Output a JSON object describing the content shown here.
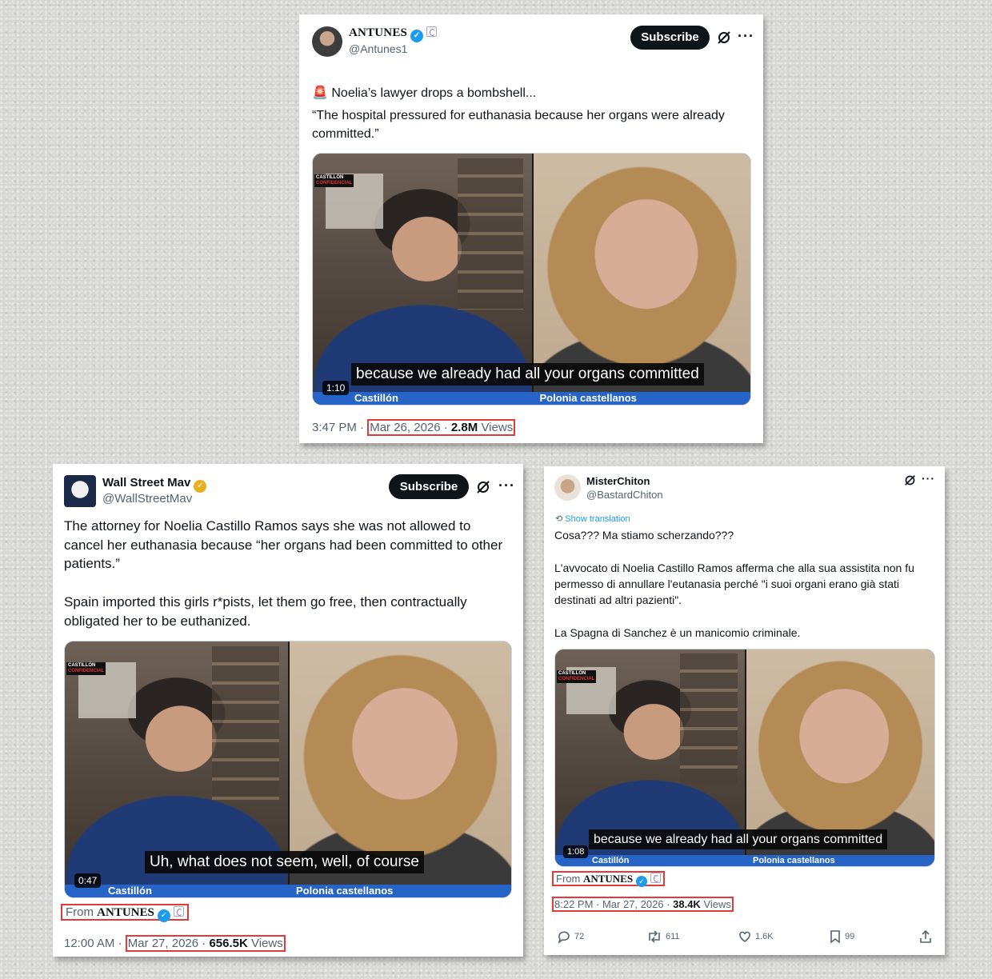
{
  "post1": {
    "author_name": "ANTUNES",
    "handle": "@Antunes1",
    "subscribe_label": "Subscribe",
    "more_label": "···",
    "emoji": "🚨",
    "text_line1": "Noelia’s lawyer drops a bombshell...",
    "text_quote": "“The hospital pressured for euthanasia because her organs were already committed.”",
    "video": {
      "caption": "because we already had all your organs committed",
      "duration": "1:10",
      "left_nameplate": "Castillón",
      "right_nameplate": "Polonia castellanos",
      "logo_line1": "CASTILLÓN",
      "logo_line2": "CONFIDENCIAL"
    },
    "time": "3:47 PM · ",
    "date": "Mar 26, 2026 · ",
    "views_count": "2.8M",
    "views_label": " Views"
  },
  "post2": {
    "author_name": "Wall Street Mav",
    "handle": "@WallStreetMav",
    "subscribe_label": "Subscribe",
    "more_label": "···",
    "text": "The attorney for Noelia Castillo Ramos says she was not allowed to cancel her euthanasia because “her organs had been committed to other patients.”\n\nSpain imported this girls r*pists, let them go free, then contractually obligated her to be euthanized.",
    "video": {
      "caption": "Uh, what does not seem, well, of course",
      "duration": "0:47",
      "left_nameplate": "Castillón",
      "right_nameplate": "Polonia castellanos",
      "logo_line1": "CASTILLÓN",
      "logo_line2": "CONFIDENCIAL"
    },
    "from_prefix": "From ",
    "from_source": "ANTUNES",
    "time": "12:00 AM · ",
    "date": "Mar 27, 2026 · ",
    "views_count": "656.5K",
    "views_label": " Views"
  },
  "post3": {
    "author_name": "MisterChiton",
    "handle": "@BastardChiton",
    "more_label": "···",
    "translate_label": "Show translation",
    "text": "Cosa??? Ma stiamo scherzando???\n\nL'avvocato di Noelia Castillo Ramos afferma che alla sua assistita non fu permesso di annullare l'eutanasia perché \"i suoi organi erano già stati destinati ad altri pazienti\".\n\nLa Spagna di Sanchez è un manicomio criminale.",
    "video": {
      "caption": "because we already had all your organs committed",
      "duration": "1:08",
      "left_nameplate": "Castillón",
      "right_nameplate": "Polonia castellanos",
      "logo_line1": "CASTILLÓN",
      "logo_line2": "CONFIDENCIAL"
    },
    "from_prefix": "From ",
    "from_source": "ANTUNES",
    "time": "8:22 PM · ",
    "date": "Mar 27, 2026 · ",
    "views_count": "38.4K",
    "views_label": " Views",
    "actions": {
      "replies": "72",
      "reposts": "611",
      "likes": "1.6K",
      "bookmarks": "99"
    }
  },
  "colors": {
    "accent_blue": "#1d9bf0",
    "highlight_red": "#e03a3a",
    "verified_gold": "#e8b021"
  },
  "icons": [
    "verified-badge-icon",
    "grok-icon",
    "more-icon",
    "reply-icon",
    "repost-icon",
    "like-icon",
    "bookmark-icon",
    "share-icon",
    "translate-icon"
  ]
}
